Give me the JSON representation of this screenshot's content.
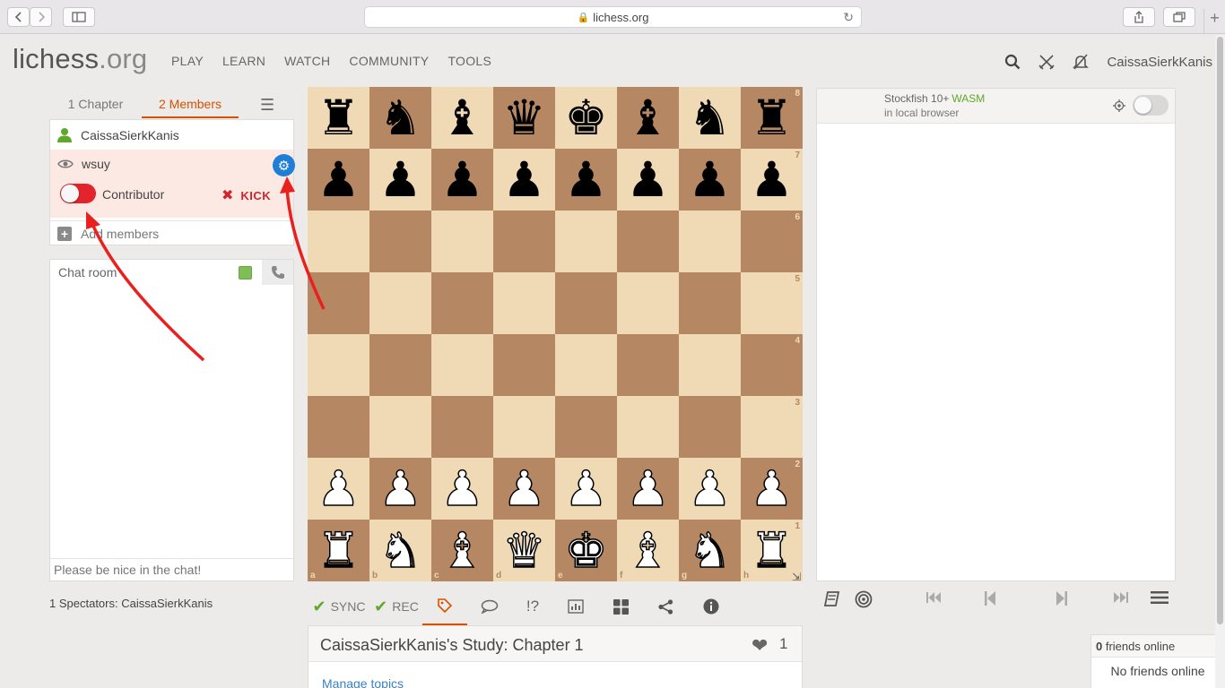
{
  "browser": {
    "url": "lichess.org"
  },
  "site": {
    "logo_main": "lichess",
    "logo_tld": ".org",
    "username": "CaissaSierkKanis"
  },
  "nav": [
    {
      "label": "PLAY"
    },
    {
      "label": "LEARN"
    },
    {
      "label": "WATCH"
    },
    {
      "label": "COMMUNITY"
    },
    {
      "label": "TOOLS"
    }
  ],
  "study_tabs": {
    "chapters": "1 Chapter",
    "members": "2 Members"
  },
  "members": {
    "owner": "CaissaSierkKanis",
    "member": "wsuy",
    "contributor_label": "Contributor",
    "contributor_enabled": true,
    "kick_label": "KICK",
    "add_label": "Add members"
  },
  "chat": {
    "title": "Chat room",
    "placeholder": "Please be nice in the chat!"
  },
  "spectators": "1 Spectators: CaissaSierkKanis",
  "board": {
    "ranks": [
      "8",
      "7",
      "6",
      "5",
      "4",
      "3",
      "2",
      "1"
    ],
    "files": [
      "a",
      "b",
      "c",
      "d",
      "e",
      "f",
      "g",
      "h"
    ],
    "fen_rows": [
      "rnbqkbnr",
      "pppppppp",
      "8",
      "8",
      "8",
      "8",
      "PPPPPPPP",
      "RNBQKBNR"
    ]
  },
  "tools": {
    "sync_label": "SYNC",
    "rec_label": "REC",
    "comment_glyph": "!?"
  },
  "study": {
    "title": "CaissaSierkKanis's Study: Chapter 1",
    "likes": "1",
    "manage_topics": "Manage topics"
  },
  "engine": {
    "name": "Stockfish 10+",
    "tag": "WASM",
    "sub": "in local browser"
  },
  "friends": {
    "count": "0",
    "label": " friends online",
    "empty": "No friends online"
  },
  "colors": {
    "accent": "#d85000",
    "board_light": "#f0d9b5",
    "board_dark": "#b58863",
    "kick": "#d1252e",
    "toggle_on": "#e2242c",
    "gear": "#1f7fd8",
    "arrow": "#e8211e"
  }
}
